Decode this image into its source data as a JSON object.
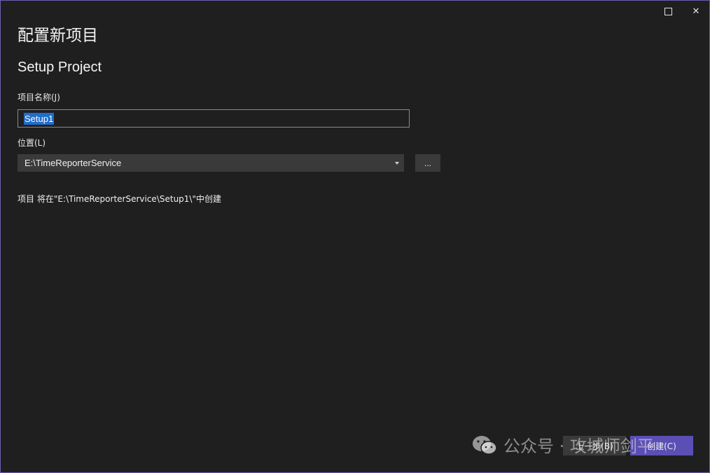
{
  "window": {
    "heading_cn": "配置新项目",
    "heading_en": "Setup Project",
    "maximize_icon": "maximize-icon",
    "close_icon": "close-icon",
    "close_glyph": "✕"
  },
  "form": {
    "name_label": "项目名称(J)",
    "name_value": "Setup1",
    "location_label": "位置(L)",
    "location_value": "E:\\TimeReporterService",
    "browse_label": "...",
    "info_text": "项目 将在\"E:\\TimeReporterService\\Setup1\\\"中创建"
  },
  "footer": {
    "back_label": "上一步(B)",
    "create_label": "创建(C)"
  },
  "watermark": {
    "text": "公众号 · 攻城师剑平",
    "icon": "wechat-icon"
  },
  "colors": {
    "background": "#1f1f1f",
    "accent": "#5b4fb5",
    "selection": "#1f6dcc",
    "control_bg": "#3a3a3a"
  }
}
